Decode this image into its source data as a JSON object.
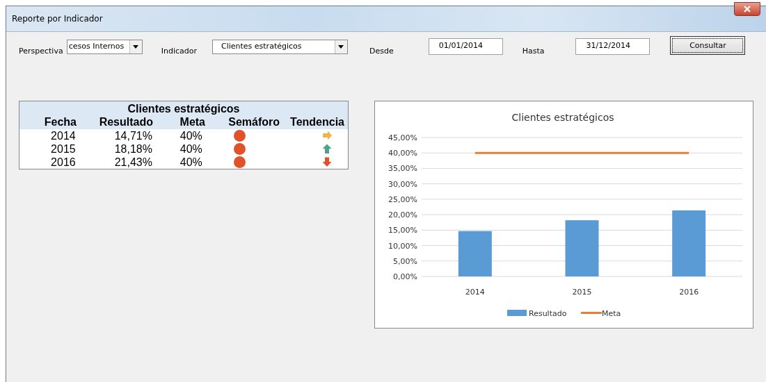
{
  "window": {
    "title": "Reporte por Indicador"
  },
  "filters": {
    "perspectiva_label": "Perspectiva",
    "perspectiva_value": "cesos Internos",
    "indicador_label": "Indicador",
    "indicador_value": "Clientes estratégicos",
    "desde_label": "Desde",
    "desde_value": "01/01/2014",
    "hasta_label": "Hasta",
    "hasta_value": "31/12/2014",
    "button": "Consultar"
  },
  "table": {
    "title": "Clientes estratégicos",
    "columns": [
      "Fecha",
      "Resultado",
      "Meta",
      "Semáforo",
      "Tendencia"
    ],
    "rows": [
      {
        "fecha": "2014",
        "resultado": "14,71%",
        "meta": "40%",
        "color": "#e0522a",
        "kind": "right"
      },
      {
        "fecha": "2015",
        "resultado": "18,18%",
        "meta": "40%",
        "color": "#e0522a",
        "kind": "up"
      },
      {
        "fecha": "2016",
        "resultado": "21,43%",
        "meta": "40%",
        "color": "#e0522a",
        "kind": "down"
      }
    ]
  },
  "chart": {
    "chart_data": {
      "type": "bar",
      "title": "Clientes estratégicos",
      "categories": [
        "2014",
        "2015",
        "2016"
      ],
      "series": [
        {
          "name": "Resultado",
          "color": "#5b9bd5",
          "type": "bar",
          "values": [
            14.7,
            18.2,
            21.4
          ]
        },
        {
          "name": "Meta",
          "color": "#ed7d31",
          "type": "line",
          "values": [
            40,
            40,
            40
          ]
        }
      ],
      "ylim": [
        0,
        45
      ],
      "grid": true,
      "legend": "bottom",
      "yticks": [
        {
          "value": 0,
          "label": "0,00%"
        },
        {
          "value": 5,
          "label": "5,00%"
        },
        {
          "value": 10,
          "label": "10,00%"
        },
        {
          "value": 15,
          "label": "15,00%"
        },
        {
          "value": 20,
          "label": "20,00%"
        },
        {
          "value": 25,
          "label": "25,00%"
        },
        {
          "value": 30,
          "label": "30,00%"
        },
        {
          "value": 35,
          "label": "35,00%"
        },
        {
          "value": 40,
          "label": "40,00%"
        },
        {
          "value": 45,
          "label": "45,00%"
        }
      ]
    }
  }
}
